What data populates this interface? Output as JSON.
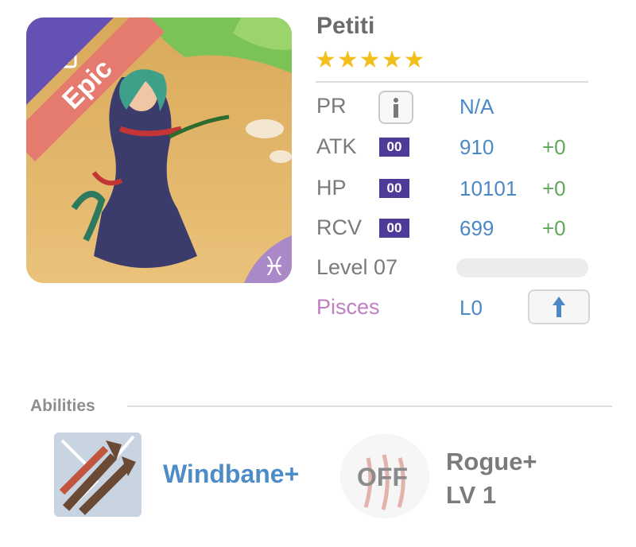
{
  "hero": {
    "name": "Petiti",
    "stars": "★★★★★",
    "rarity": "Epic",
    "rarity_tag_icon": "R",
    "zodiac_glyph": "♓"
  },
  "stats": {
    "pr_label": "PR",
    "pr_value": "N/A",
    "atk_label": "ATK",
    "atk_badge": "00",
    "atk_value": "910",
    "atk_plus": "+0",
    "hp_label": "HP",
    "hp_badge": "00",
    "hp_value": "10101",
    "hp_plus": "+0",
    "rcv_label": "RCV",
    "rcv_badge": "00",
    "rcv_value": "699",
    "rcv_plus": "+0",
    "level_label": "Level 07",
    "zodiac_label": "Pisces",
    "zodiac_level": "L0"
  },
  "abilities": {
    "title": "Abilities",
    "ability1_name": "Windbane+",
    "ability2_status": "OFF",
    "ability2_name": "Rogue+",
    "ability2_level": "LV 1"
  },
  "colors": {
    "epic": "#e57b6e",
    "purple": "#6550b3",
    "value_blue": "#4b89c6",
    "plus_green": "#62a65c",
    "pisces_pink": "#c07fc0",
    "star_gold": "#f3bf1c"
  },
  "icons": [
    "info-icon",
    "arrow-up-icon",
    "windbane-icon",
    "rogue-claw-icon",
    "pisces-icon",
    "rarity-r-icon"
  ]
}
